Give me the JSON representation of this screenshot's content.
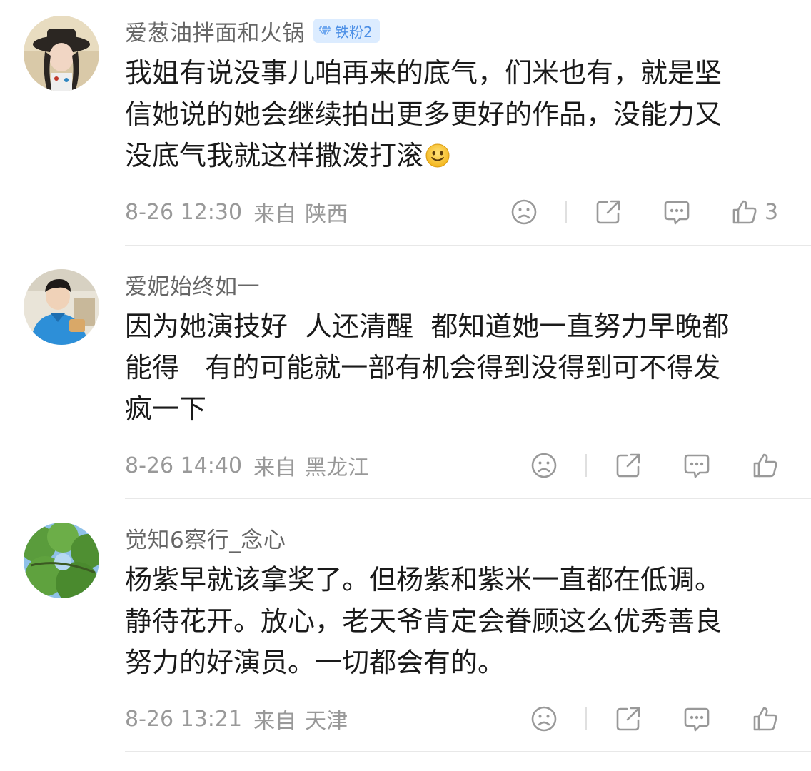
{
  "comments": [
    {
      "username": "爱葱油拌面和火锅",
      "badge": "铁粉2",
      "lines": [
        "我姐有说没事儿咱再来的底气，们米也有，就是坚",
        "信她说的她会继续拍出更多更好的作品，没能力又",
        "没底气我就这样撒泼打滚"
      ],
      "emoji": "smile-emoji",
      "time": "8-26 12:30",
      "from_label": "来自",
      "location": "陕西",
      "like_count": "3"
    },
    {
      "username": "爱妮始终如一",
      "lines": [
        "因为她演技好  人还清醒  都知道她一直努力早晚都",
        "能得   有的可能就一部有机会得到没得到可不得发",
        "疯一下"
      ],
      "time": "8-26 14:40",
      "from_label": "来自",
      "location": "黑龙江",
      "like_count": ""
    },
    {
      "username": "觉知6察行_念心",
      "lines": [
        "杨紫早就该拿奖了。但杨紫和紫米一直都在低调。",
        "静待花开。放心，老天爷肯定会眷顾这么优秀善良",
        "努力的好演员。一切都会有的。"
      ],
      "time": "8-26 13:21",
      "from_label": "来自",
      "location": "天津",
      "like_count": ""
    }
  ],
  "icons": {
    "dislike": "frown-face-icon",
    "share": "share-icon",
    "reply": "comment-bubble-icon",
    "like": "thumbs-up-icon",
    "badge": "diamond-icon"
  },
  "colors": {
    "username": "#666666",
    "meta": "#999999",
    "badge_bg": "#dcecff",
    "badge_text": "#4c8fe6",
    "content": "#1a1a1a",
    "divider": "#e8e8e8"
  }
}
